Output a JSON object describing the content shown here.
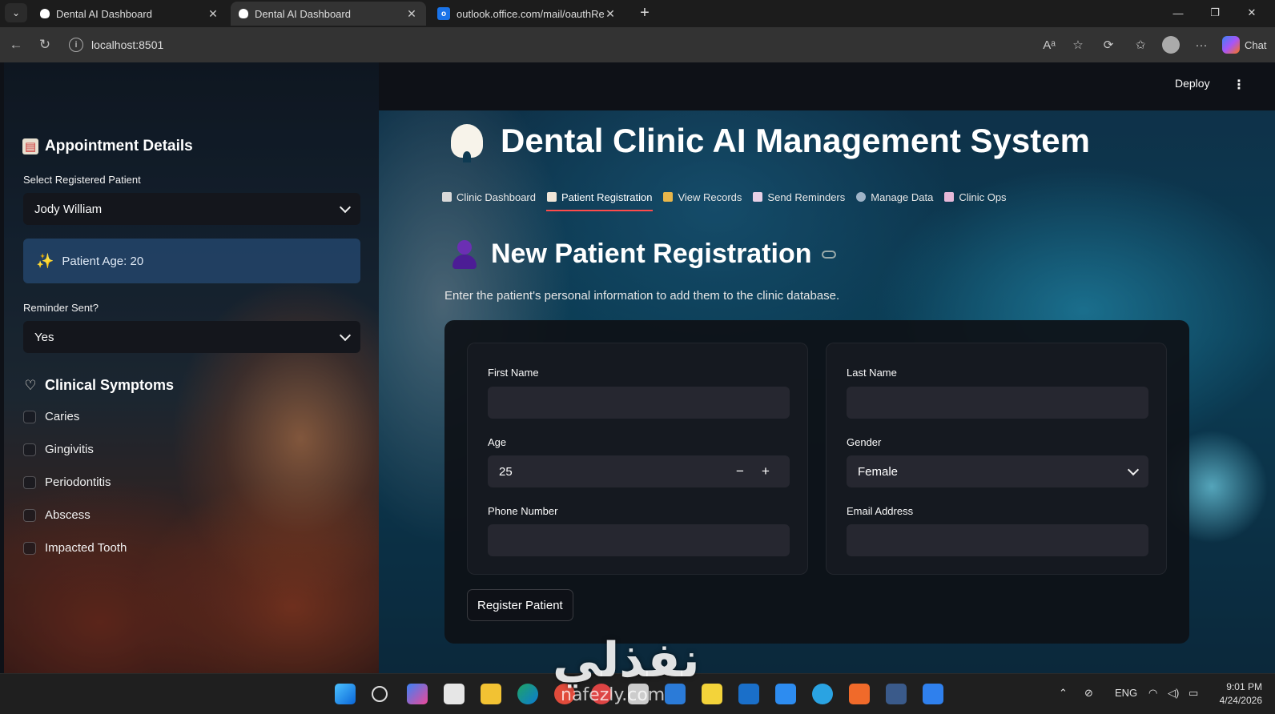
{
  "browser": {
    "tabs": [
      {
        "title": "Dental AI Dashboard",
        "active": false
      },
      {
        "title": "Dental AI Dashboard",
        "active": true
      },
      {
        "title": "outlook.office.com/mail/oauthRed",
        "active": false
      }
    ],
    "url": "localhost:8501",
    "chat_label": "Chat"
  },
  "header": {
    "deploy_label": "Deploy"
  },
  "sidebar": {
    "appointment_title": "Appointment Details",
    "select_patient_label": "Select Registered Patient",
    "selected_patient": "Jody William",
    "patient_age_text": "Patient Age: 20",
    "reminder_label": "Reminder Sent?",
    "reminder_value": "Yes",
    "symptoms_title": "Clinical Symptoms",
    "symptoms": [
      {
        "label": "Caries",
        "checked": false
      },
      {
        "label": "Gingivitis",
        "checked": false
      },
      {
        "label": "Periodontitis",
        "checked": false
      },
      {
        "label": "Abscess",
        "checked": false
      },
      {
        "label": "Impacted Tooth",
        "checked": false
      }
    ]
  },
  "main": {
    "title": "Dental Clinic AI Management System",
    "tabs": [
      {
        "label": "Clinic Dashboard",
        "active": false
      },
      {
        "label": "Patient Registration",
        "active": true
      },
      {
        "label": "View Records",
        "active": false
      },
      {
        "label": "Send Reminders",
        "active": false
      },
      {
        "label": "Manage Data",
        "active": false
      },
      {
        "label": "Clinic Ops",
        "active": false
      }
    ],
    "section_title": "New Patient Registration",
    "caption": "Enter the patient's personal information to add them to the clinic database.",
    "form": {
      "first_name_label": "First Name",
      "first_name_value": "",
      "last_name_label": "Last Name",
      "last_name_value": "",
      "age_label": "Age",
      "age_value": "25",
      "gender_label": "Gender",
      "gender_value": "Female",
      "phone_label": "Phone Number",
      "phone_value": "",
      "email_label": "Email Address",
      "email_value": "",
      "submit_label": "Register Patient"
    }
  },
  "taskbar": {
    "language": "ENG",
    "time": "9:01 PM",
    "date": "4/24/2026"
  },
  "watermark": {
    "text": "نفذلي",
    "subtext": "nafezly.com"
  },
  "colors": {
    "accent": "#ff4b4b",
    "app_bg": "#0e1117",
    "input_bg": "#262730"
  }
}
